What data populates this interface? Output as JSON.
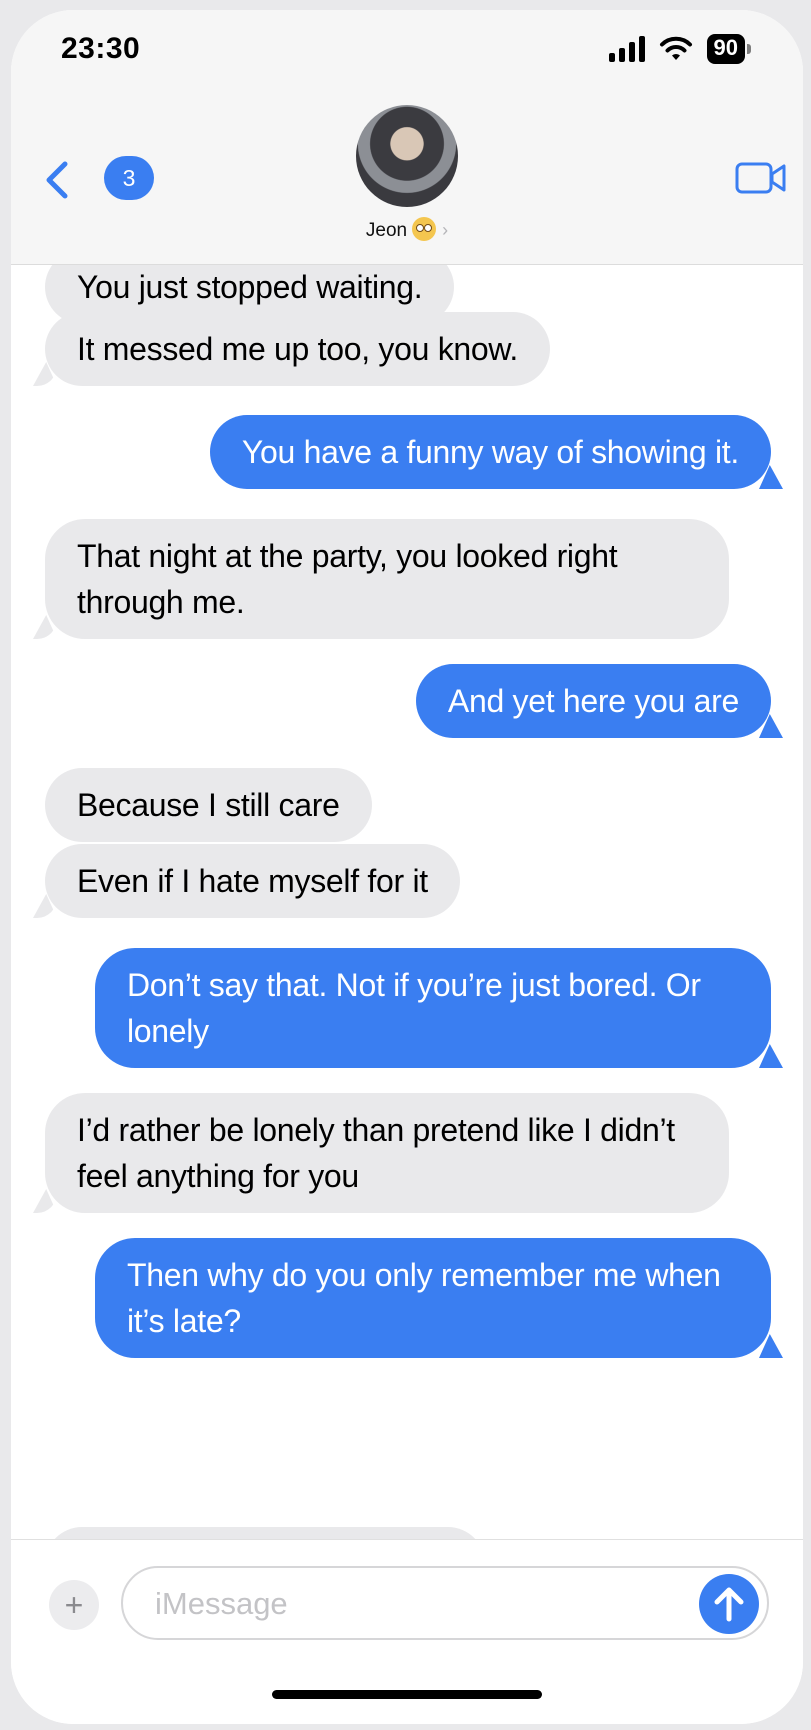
{
  "status_bar": {
    "time": "23:30",
    "battery": "90"
  },
  "header": {
    "unread_badge": "3",
    "contact_name": "Jeon",
    "contact_emoji": "face-with-rolling-eyes-icon"
  },
  "messages": [
    {
      "from": "them",
      "text": "You just stopped waiting."
    },
    {
      "from": "them",
      "text": "It messed me up too, you know."
    },
    {
      "from": "me",
      "text": "You have a funny way of showing it."
    },
    {
      "from": "them",
      "text": "That night at the party, you looked right through me."
    },
    {
      "from": "me",
      "text": "And yet here you are"
    },
    {
      "from": "them",
      "text": "Because I still care"
    },
    {
      "from": "them",
      "text": "Even if I hate myself for it"
    },
    {
      "from": "me",
      "text": "Don’t say that. Not if you’re just bored. Or lonely"
    },
    {
      "from": "them",
      "text": "I’d rather be lonely than pretend like I didn’t feel anything for you"
    },
    {
      "from": "me",
      "text": "Then why do you only remember me when it’s late?"
    }
  ],
  "composer": {
    "placeholder": "iMessage"
  },
  "colors": {
    "outgoing_bubble": "#3a7ef1",
    "incoming_bubble": "#e9e9eb",
    "accent": "#3a7ef1"
  }
}
